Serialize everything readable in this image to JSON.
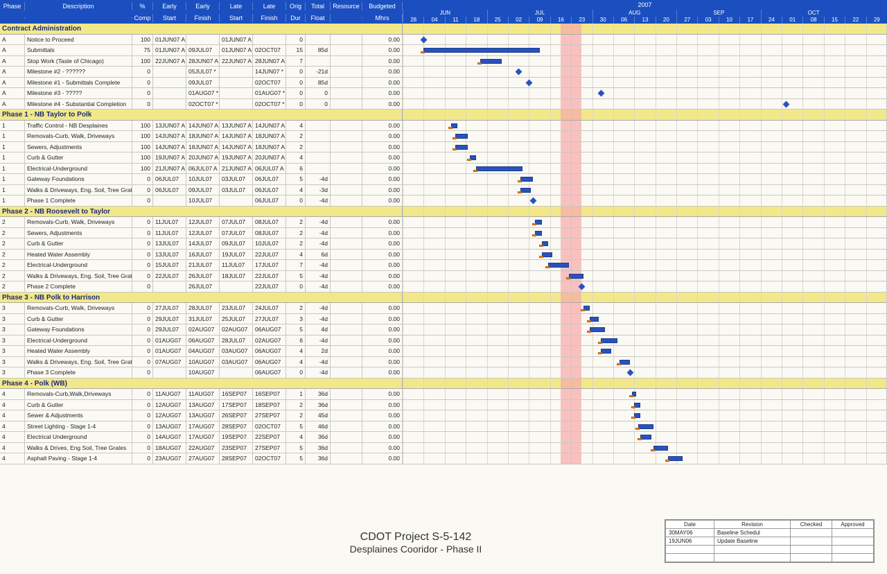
{
  "columns": {
    "phase": "Phase",
    "desc": "Description",
    "pct1": "%",
    "pct2": "Comp",
    "es1": "Early",
    "es2": "Start",
    "ef1": "Early",
    "ef2": "Finish",
    "ls1": "Late",
    "ls2": "Start",
    "lf1": "Late",
    "lf2": "Finish",
    "od1": "Orig",
    "od2": "Dur",
    "tf1": "Total",
    "tf2": "Float",
    "res": "Resource",
    "bm1": "Budgeted",
    "bm2": "Mhrs"
  },
  "timeline": {
    "year": "2007",
    "months": [
      {
        "label": "JUN",
        "weeks": 4
      },
      {
        "label": "JUL",
        "weeks": 5
      },
      {
        "label": "AUG",
        "weeks": 4
      },
      {
        "label": "SEP",
        "weeks": 4
      },
      {
        "label": "OCT",
        "weeks": 5
      }
    ],
    "days": [
      "28",
      "04",
      "11",
      "18",
      "25",
      "02",
      "09",
      "16",
      "23",
      "30",
      "06",
      "13",
      "20",
      "27",
      "03",
      "10",
      "17",
      "24",
      "01",
      "08",
      "15",
      "22",
      "29"
    ],
    "highlight_week_index": 8,
    "start_date": "2007-05-28",
    "total_weeks": 23
  },
  "groups": [
    {
      "title": "Contract Administration",
      "rows": [
        {
          "ph": "A",
          "desc": "Notice to Proceed",
          "pct": "100",
          "es": "01JUN07 A",
          "ef": "",
          "ls": "01JUN07 A",
          "lf": "",
          "od": "0",
          "tf": "",
          "bm": "0.00",
          "bar": {
            "s": 1,
            "d": 0,
            "ms": true
          }
        },
        {
          "ph": "A",
          "desc": "Submittals",
          "pct": "75",
          "es": "01JUN07 A",
          "ef": "09JUL07",
          "ls": "01JUN07 A",
          "lf": "02OCT07",
          "od": "15",
          "tf": "85d",
          "bm": "0.00",
          "bar": {
            "s": 1,
            "d": 5.5
          }
        },
        {
          "ph": "A",
          "desc": "Stop Work (Taste of Chicago)",
          "pct": "100",
          "es": "22JUN07 A",
          "ef": "28JUN07 A",
          "ls": "22JUN07 A",
          "lf": "28JUN07 A",
          "od": "7",
          "tf": "",
          "bm": "0.00",
          "bar": {
            "s": 3.7,
            "d": 1
          }
        },
        {
          "ph": "A",
          "desc": "Milestone #2 - ??????",
          "pct": "0",
          "es": "",
          "ef": "05JUL07 *",
          "ls": "",
          "lf": "14JUN07 *",
          "od": "0",
          "tf": "-21d",
          "bm": "0.00",
          "bar": {
            "s": 5.5,
            "d": 0,
            "ms": true
          }
        },
        {
          "ph": "A",
          "desc": "Milestone #1 - Submittals Complete",
          "pct": "0",
          "es": "",
          "ef": "09JUL07",
          "ls": "",
          "lf": "02OCT07",
          "od": "0",
          "tf": "85d",
          "bm": "0.00",
          "bar": {
            "s": 6,
            "d": 0,
            "ms": true
          }
        },
        {
          "ph": "A",
          "desc": "Milestone #3 - ?????",
          "pct": "0",
          "es": "",
          "ef": "01AUG07 *",
          "ls": "",
          "lf": "01AUG07 *",
          "od": "0",
          "tf": "0",
          "bm": "0.00",
          "bar": {
            "s": 9.4,
            "d": 0,
            "ms": true
          }
        },
        {
          "ph": "A",
          "desc": "Milestone #4 - Substantial Completion",
          "pct": "0",
          "es": "",
          "ef": "02OCT07 *",
          "ls": "",
          "lf": "02OCT07 *",
          "od": "0",
          "tf": "0",
          "bm": "0.00",
          "bar": {
            "s": 18.2,
            "d": 0,
            "ms": true
          }
        }
      ]
    },
    {
      "title": "Phase 1 - NB Taylor to Polk",
      "rows": [
        {
          "ph": "1",
          "desc": "Traffic Control - NB Desplaines",
          "pct": "100",
          "es": "13JUN07 A",
          "ef": "14JUN07 A",
          "ls": "13JUN07 A",
          "lf": "14JUN07 A",
          "od": "4",
          "tf": "",
          "bm": "0.00",
          "bar": {
            "s": 2.3,
            "d": 0.3
          }
        },
        {
          "ph": "1",
          "desc": "Removals-Curb, Walk, Driveways",
          "pct": "100",
          "es": "14JUN07 A",
          "ef": "18JUN07 A",
          "ls": "14JUN07 A",
          "lf": "18JUN07 A",
          "od": "2",
          "tf": "",
          "bm": "0.00",
          "bar": {
            "s": 2.5,
            "d": 0.6
          }
        },
        {
          "ph": "1",
          "desc": "Sewers, Adjustments",
          "pct": "100",
          "es": "14JUN07 A",
          "ef": "18JUN07 A",
          "ls": "14JUN07 A",
          "lf": "18JUN07 A",
          "od": "2",
          "tf": "",
          "bm": "0.00",
          "bar": {
            "s": 2.5,
            "d": 0.6
          }
        },
        {
          "ph": "1",
          "desc": "Curb & Gutter",
          "pct": "100",
          "es": "19JUN07 A",
          "ef": "20JUN07 A",
          "ls": "19JUN07 A",
          "lf": "20JUN07 A",
          "od": "4",
          "tf": "",
          "bm": "0.00",
          "bar": {
            "s": 3.2,
            "d": 0.3
          }
        },
        {
          "ph": "1",
          "desc": "Electrical-Underground",
          "pct": "100",
          "es": "21JUN07 A",
          "ef": "06JUL07 A",
          "ls": "21JUN07 A",
          "lf": "06JUL07 A",
          "od": "6",
          "tf": "",
          "bm": "0.00",
          "bar": {
            "s": 3.5,
            "d": 2.2
          }
        },
        {
          "ph": "1",
          "desc": "Gateway Foundations",
          "pct": "0",
          "es": "06JUL07",
          "ef": "10JUL07",
          "ls": "03JUL07",
          "lf": "06JUL07",
          "od": "5",
          "tf": "-4d",
          "bm": "0.00",
          "bar": {
            "s": 5.6,
            "d": 0.6
          }
        },
        {
          "ph": "1",
          "desc": "Walks & Driveways, Eng. Soil, Tree Grates",
          "pct": "0",
          "es": "06JUL07",
          "ef": "09JUL07",
          "ls": "03JUL07",
          "lf": "06JUL07",
          "od": "4",
          "tf": "-3d",
          "bm": "0.00",
          "bar": {
            "s": 5.6,
            "d": 0.5
          }
        },
        {
          "ph": "1",
          "desc": "Phase 1 Complete",
          "pct": "0",
          "es": "",
          "ef": "10JUL07",
          "ls": "",
          "lf": "06JUL07",
          "od": "0",
          "tf": "-4d",
          "bm": "0.00",
          "bar": {
            "s": 6.2,
            "d": 0,
            "ms": true
          }
        }
      ]
    },
    {
      "title": "Phase 2 - NB Roosevelt to Taylor",
      "rows": [
        {
          "ph": "2",
          "desc": "Removals-Curb, Walk, Driveways",
          "pct": "0",
          "es": "11JUL07",
          "ef": "12JUL07",
          "ls": "07JUL07",
          "lf": "08JUL07",
          "od": "2",
          "tf": "-4d",
          "bm": "0.00",
          "bar": {
            "s": 6.3,
            "d": 0.3
          }
        },
        {
          "ph": "2",
          "desc": "Sewers, Adjustments",
          "pct": "0",
          "es": "11JUL07",
          "ef": "12JUL07",
          "ls": "07JUL07",
          "lf": "08JUL07",
          "od": "2",
          "tf": "-4d",
          "bm": "0.00",
          "bar": {
            "s": 6.3,
            "d": 0.3
          }
        },
        {
          "ph": "2",
          "desc": "Curb & Gutter",
          "pct": "0",
          "es": "13JUL07",
          "ef": "14JUL07",
          "ls": "09JUL07",
          "lf": "10JUL07",
          "od": "2",
          "tf": "-4d",
          "bm": "0.00",
          "bar": {
            "s": 6.6,
            "d": 0.3
          }
        },
        {
          "ph": "2",
          "desc": "Heated Water Assembly",
          "pct": "0",
          "es": "13JUL07",
          "ef": "16JUL07",
          "ls": "19JUL07",
          "lf": "22JUL07",
          "od": "4",
          "tf": "6d",
          "bm": "0.00",
          "bar": {
            "s": 6.6,
            "d": 0.5
          }
        },
        {
          "ph": "2",
          "desc": "Electrical-Underground",
          "pct": "0",
          "es": "15JUL07",
          "ef": "21JUL07",
          "ls": "11JUL07",
          "lf": "17JUL07",
          "od": "7",
          "tf": "-4d",
          "bm": "0.00",
          "bar": {
            "s": 6.9,
            "d": 1
          }
        },
        {
          "ph": "2",
          "desc": "Walks & Driveways, Eng. Soil, Tree Grates",
          "pct": "0",
          "es": "22JUL07",
          "ef": "26JUL07",
          "ls": "18JUL07",
          "lf": "22JUL07",
          "od": "5",
          "tf": "-4d",
          "bm": "0.00",
          "bar": {
            "s": 7.9,
            "d": 0.7
          }
        },
        {
          "ph": "2",
          "desc": "Phase 2 Complete",
          "pct": "0",
          "es": "",
          "ef": "26JUL07",
          "ls": "",
          "lf": "22JUL07",
          "od": "0",
          "tf": "-4d",
          "bm": "0.00",
          "bar": {
            "s": 8.5,
            "d": 0,
            "ms": true
          }
        }
      ]
    },
    {
      "title": "Phase 3 - NB Polk to Harrison",
      "rows": [
        {
          "ph": "3",
          "desc": "Removals-Curb, Walk, Driveways",
          "pct": "0",
          "es": "27JUL07",
          "ef": "28JUL07",
          "ls": "23JUL07",
          "lf": "24JUL07",
          "od": "2",
          "tf": "-4d",
          "bm": "0.00",
          "bar": {
            "s": 8.6,
            "d": 0.3
          }
        },
        {
          "ph": "3",
          "desc": "Curb & Gutter",
          "pct": "0",
          "es": "29JUL07",
          "ef": "31JUL07",
          "ls": "25JUL07",
          "lf": "27JUL07",
          "od": "3",
          "tf": "-4d",
          "bm": "0.00",
          "bar": {
            "s": 8.9,
            "d": 0.4
          }
        },
        {
          "ph": "3",
          "desc": "Gateway Foundations",
          "pct": "0",
          "es": "29JUL07",
          "ef": "02AUG07",
          "ls": "02AUG07",
          "lf": "06AUG07",
          "od": "5",
          "tf": "4d",
          "bm": "0.00",
          "bar": {
            "s": 8.9,
            "d": 0.7
          }
        },
        {
          "ph": "3",
          "desc": "Electrical-Underground",
          "pct": "0",
          "es": "01AUG07",
          "ef": "06AUG07",
          "ls": "28JUL07",
          "lf": "02AUG07",
          "od": "6",
          "tf": "-4d",
          "bm": "0.00",
          "bar": {
            "s": 9.4,
            "d": 0.8
          }
        },
        {
          "ph": "3",
          "desc": "Heated Water Assembly",
          "pct": "0",
          "es": "01AUG07",
          "ef": "04AUG07",
          "ls": "03AUG07",
          "lf": "06AUG07",
          "od": "4",
          "tf": "2d",
          "bm": "0.00",
          "bar": {
            "s": 9.4,
            "d": 0.5
          }
        },
        {
          "ph": "3",
          "desc": "Walks & Driveways, Eng. Soil, Tree Grates",
          "pct": "0",
          "es": "07AUG07",
          "ef": "10AUG07",
          "ls": "03AUG07",
          "lf": "06AUG07",
          "od": "4",
          "tf": "-4d",
          "bm": "0.00",
          "bar": {
            "s": 10.3,
            "d": 0.5
          }
        },
        {
          "ph": "3",
          "desc": "Phase 3 Complete",
          "pct": "0",
          "es": "",
          "ef": "10AUG07",
          "ls": "",
          "lf": "06AUG07",
          "od": "0",
          "tf": "-4d",
          "bm": "0.00",
          "bar": {
            "s": 10.8,
            "d": 0,
            "ms": true
          }
        }
      ]
    },
    {
      "title": "Phase 4 - Polk (WB)",
      "rows": [
        {
          "ph": "4",
          "desc": "Removals-Curb,Walk,Driveways",
          "pct": "0",
          "es": "11AUG07",
          "ef": "11AUG07",
          "ls": "16SEP07",
          "lf": "16SEP07",
          "od": "1",
          "tf": "36d",
          "bm": "0.00",
          "bar": {
            "s": 10.9,
            "d": 0.2
          }
        },
        {
          "ph": "4",
          "desc": "Curb & Gutter",
          "pct": "0",
          "es": "12AUG07",
          "ef": "13AUG07",
          "ls": "17SEP07",
          "lf": "18SEP07",
          "od": "2",
          "tf": "36d",
          "bm": "0.00",
          "bar": {
            "s": 11,
            "d": 0.3
          }
        },
        {
          "ph": "4",
          "desc": "Sewer & Adjustments",
          "pct": "0",
          "es": "12AUG07",
          "ef": "13AUG07",
          "ls": "26SEP07",
          "lf": "27SEP07",
          "od": "2",
          "tf": "45d",
          "bm": "0.00",
          "bar": {
            "s": 11,
            "d": 0.3
          }
        },
        {
          "ph": "4",
          "desc": "Street Lighting - Stage 1-4",
          "pct": "0",
          "es": "13AUG07",
          "ef": "17AUG07",
          "ls": "28SEP07",
          "lf": "02OCT07",
          "od": "5",
          "tf": "46d",
          "bm": "0.00",
          "bar": {
            "s": 11.2,
            "d": 0.7
          }
        },
        {
          "ph": "4",
          "desc": "Electrical Underground",
          "pct": "0",
          "es": "14AUG07",
          "ef": "17AUG07",
          "ls": "19SEP07",
          "lf": "22SEP07",
          "od": "4",
          "tf": "36d",
          "bm": "0.00",
          "bar": {
            "s": 11.3,
            "d": 0.5
          }
        },
        {
          "ph": "4",
          "desc": "Walks & Drives, Eng Soil, Tree Grates",
          "pct": "0",
          "es": "18AUG07",
          "ef": "22AUG07",
          "ls": "23SEP07",
          "lf": "27SEP07",
          "od": "5",
          "tf": "36d",
          "bm": "0.00",
          "bar": {
            "s": 11.9,
            "d": 0.7
          }
        },
        {
          "ph": "4",
          "desc": "Asphalt Paving - Stage 1-4",
          "pct": "0",
          "es": "23AUG07",
          "ef": "27AUG07",
          "ls": "28SEP07",
          "lf": "02OCT07",
          "od": "5",
          "tf": "36d",
          "bm": "0.00",
          "bar": {
            "s": 12.6,
            "d": 0.7
          }
        }
      ]
    }
  ],
  "title": {
    "l1": "CDOT Project S-5-142",
    "l2": "Desplaines Cooridor - Phase II"
  },
  "revisions": {
    "hdr": {
      "date": "Date",
      "rev": "Revision",
      "chk": "Checked",
      "app": "Approved"
    },
    "rows": [
      {
        "date": "30MAY06",
        "rev": "Baseline Schedul",
        "chk": "",
        "app": ""
      },
      {
        "date": "19JUN06",
        "rev": "Update Baseline",
        "chk": "",
        "app": ""
      },
      {
        "date": "",
        "rev": "",
        "chk": "",
        "app": ""
      },
      {
        "date": "",
        "rev": "",
        "chk": "",
        "app": ""
      }
    ]
  },
  "chart_data": {
    "type": "gantt",
    "x_axis": "calendar weeks",
    "x_range": [
      "28MAY07",
      "29OCT07"
    ],
    "note": "bars positioned by Early Start/Finish; orange overlay = baseline (Late dates); red band = week of 16JUL07-23JUL07 (data/status date)",
    "series": "see groups[].rows[].bar {s=start-week-offset-from-28MAY07, d=duration-weeks, ms=milestone}"
  }
}
